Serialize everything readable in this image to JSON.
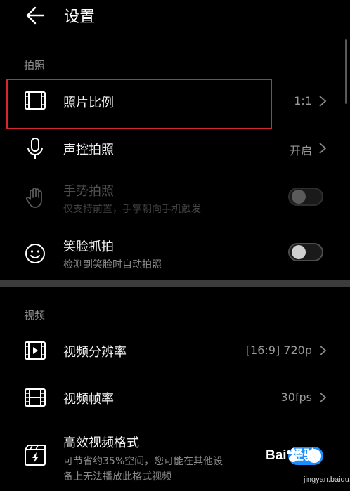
{
  "header": {
    "title": "设置",
    "back_icon": "arrow-left-icon"
  },
  "sections": {
    "photo": {
      "label": "拍照"
    },
    "video": {
      "label": "视频"
    }
  },
  "rows": {
    "photo_ratio": {
      "title": "照片比例",
      "value": "1:1",
      "icon": "frame-icon"
    },
    "voice_capture": {
      "title": "声控拍照",
      "value": "开启",
      "icon": "microphone-icon"
    },
    "gesture_capture": {
      "title": "手势拍照",
      "subtitle": "仅支持前置，手掌朝向手机触发",
      "icon": "hand-icon",
      "enabled": false,
      "toggle_on": false
    },
    "smile_capture": {
      "title": "笑脸抓拍",
      "subtitle": "检测到笑脸时自动拍照",
      "icon": "smile-icon",
      "toggle_on": false
    },
    "video_resolution": {
      "title": "视频分辨率",
      "value": "[16:9] 720p",
      "icon": "video-frame-icon"
    },
    "video_fps": {
      "title": "视频帧率",
      "value": "30fps",
      "icon": "film-strip-icon"
    },
    "efficient_format": {
      "title": "高效视频格式",
      "subtitle_line1": "可节省约35%空间，您可能在其他设",
      "subtitle_line2": "备上无法播放此格式视频",
      "icon": "clapper-flash-icon",
      "toggle_on": true
    }
  },
  "watermark": {
    "logo": "Bai 经验",
    "sub": "jingyan.baidu.com"
  },
  "colors": {
    "background": "#000000",
    "accent": "#1a8dff",
    "highlight": "#d7262e",
    "secondary_text": "#8c8c8c"
  }
}
